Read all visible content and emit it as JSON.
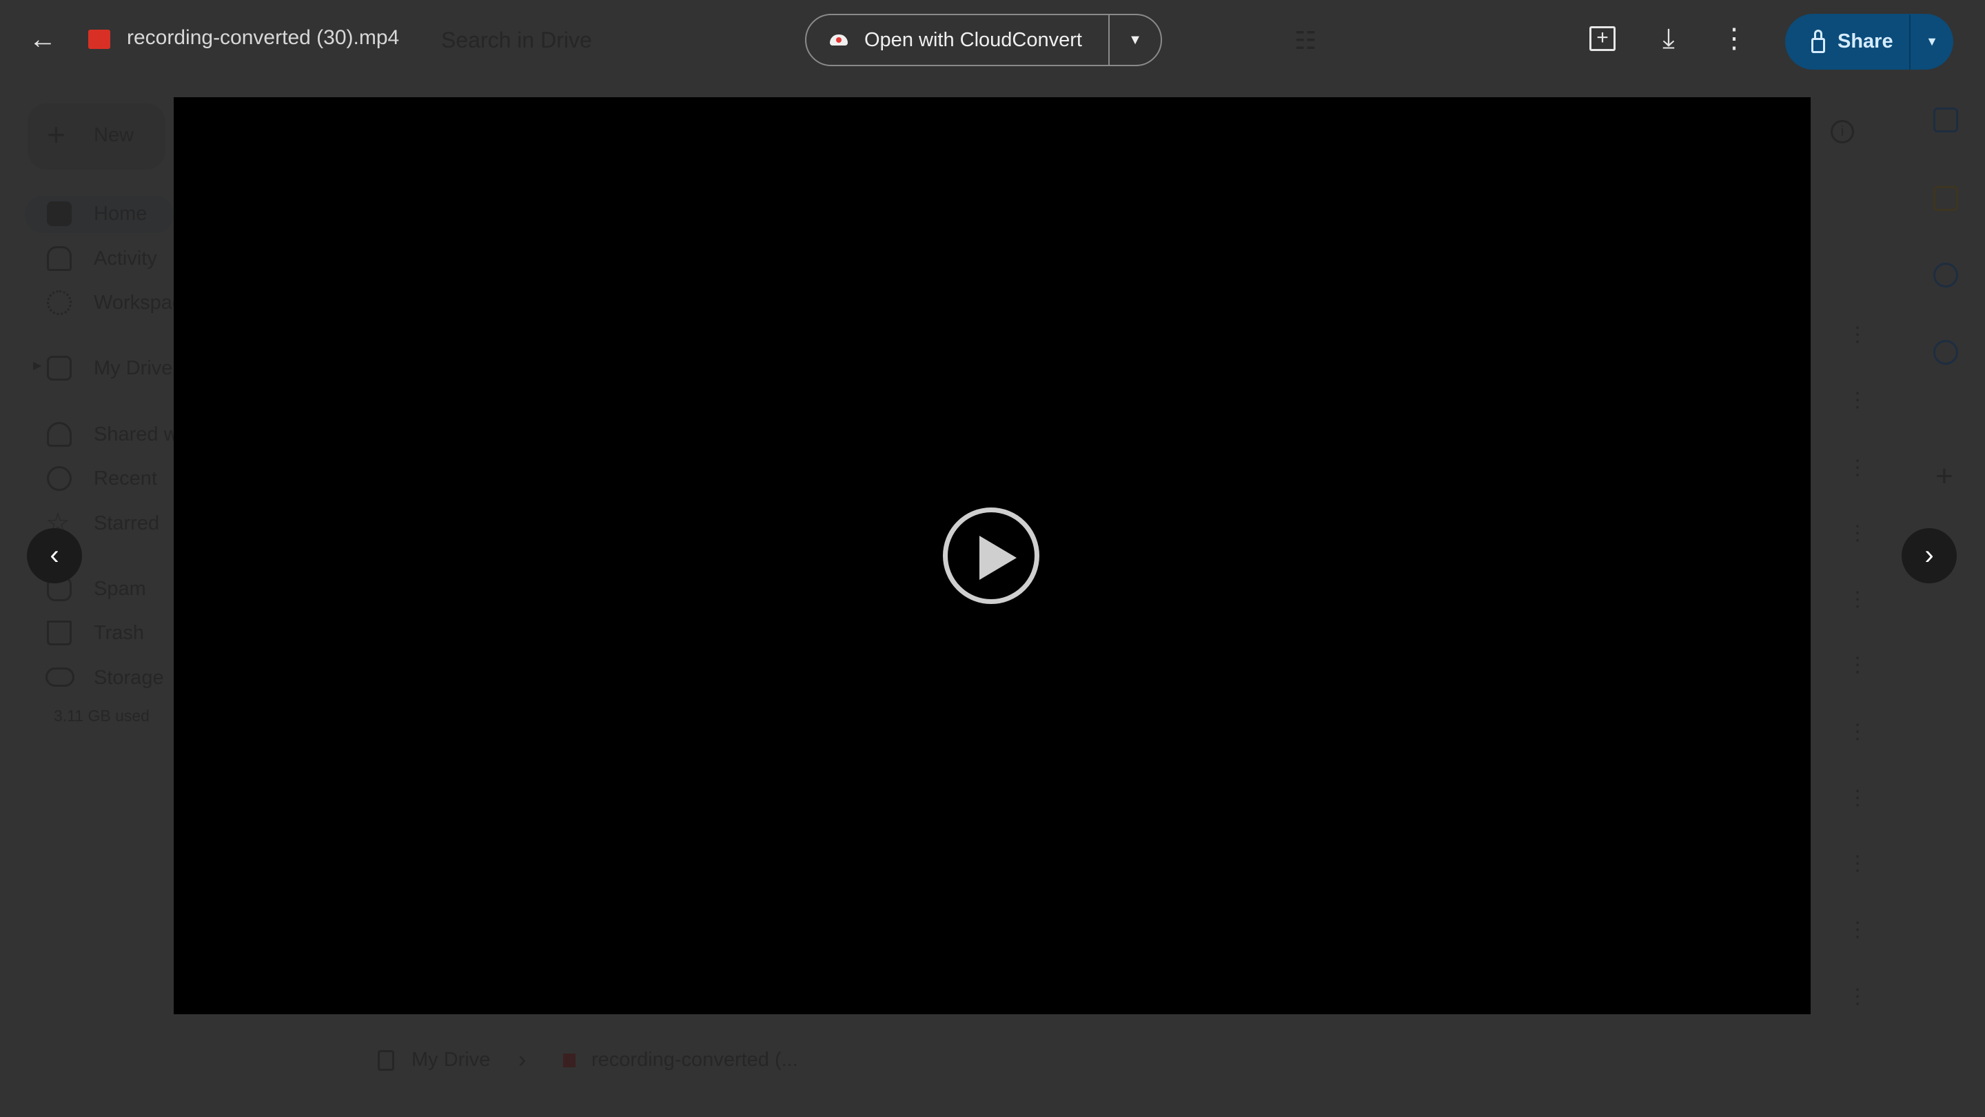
{
  "viewer": {
    "file_name": "recording-converted (30).mp4",
    "open_with_label": "Open with CloudConvert",
    "share_label": "Share",
    "accent_color": "#0b4c7a"
  },
  "background": {
    "search_placeholder": "Search in Drive",
    "new_label": "New",
    "sidebar": [
      {
        "label": "Home",
        "icon": "home-icon"
      },
      {
        "label": "Activity",
        "icon": "bell-icon"
      },
      {
        "label": "Workspaces",
        "icon": "workspaces-icon"
      },
      {
        "label": "My Drive",
        "icon": "my-drive-icon"
      },
      {
        "label": "Shared with me",
        "icon": "people-icon"
      },
      {
        "label": "Recent",
        "icon": "clock-icon"
      },
      {
        "label": "Starred",
        "icon": "star-icon"
      },
      {
        "label": "Spam",
        "icon": "spam-icon"
      },
      {
        "label": "Trash",
        "icon": "trash-icon"
      },
      {
        "label": "Storage",
        "icon": "cloud-icon"
      }
    ],
    "storage_used": "3.11 GB used",
    "breadcrumb": [
      "My Drive",
      "recording-converted (..."
    ]
  }
}
